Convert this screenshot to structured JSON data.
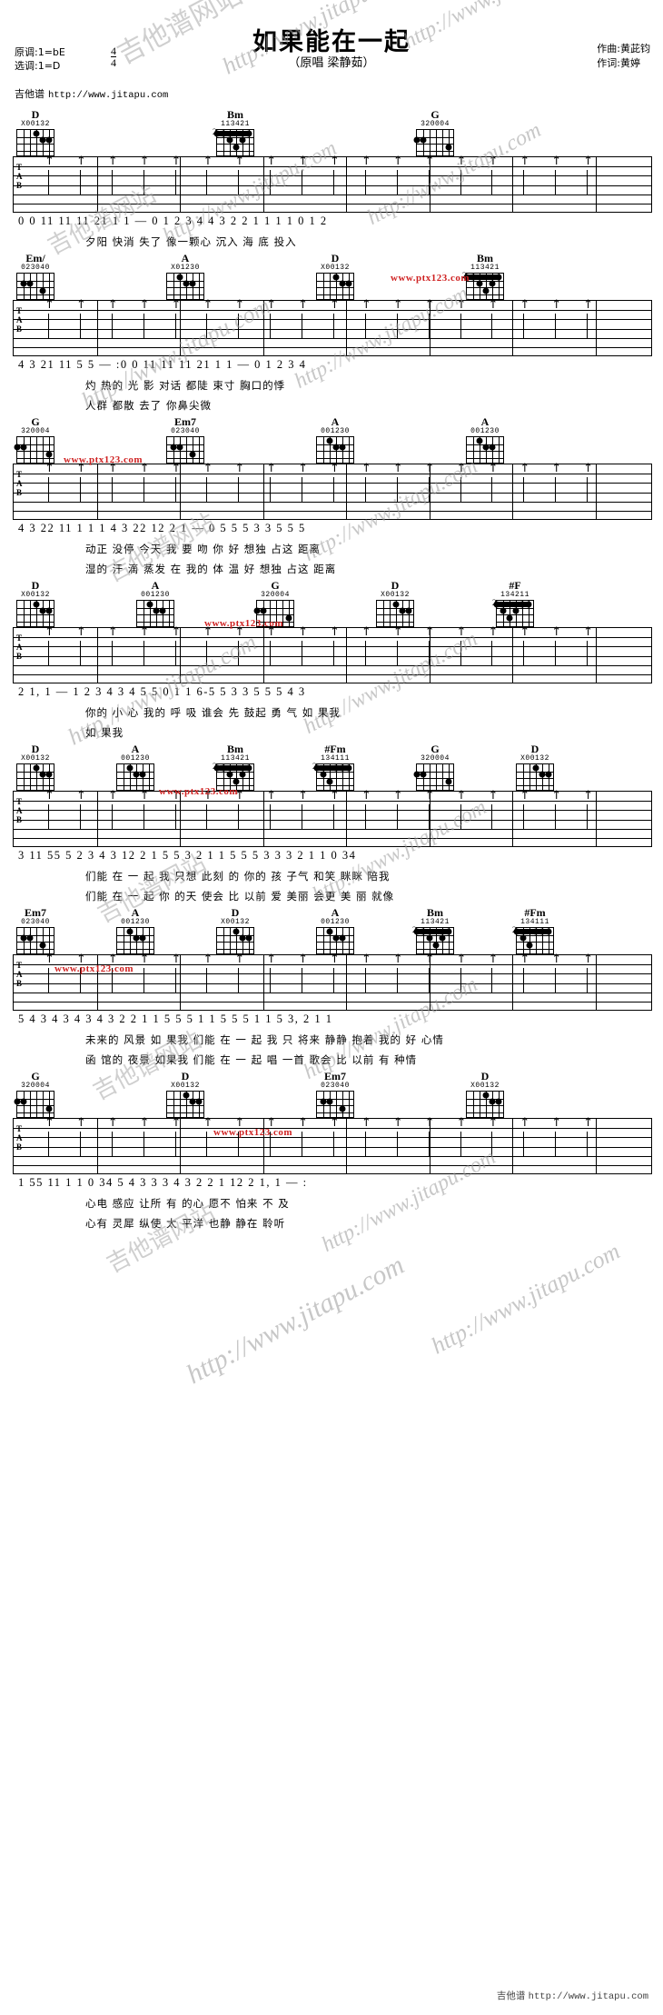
{
  "header": {
    "title": "如果能在一起",
    "subtitle": "（原唱 梁静茹）",
    "original_key_label": "原调:1=bE",
    "selected_key_label": "选调:1=D",
    "meter_numerator": "4",
    "meter_denominator": "4",
    "site_name": "吉他谱",
    "site_url": "http://www.jitapu.com",
    "composer": "作曲:黄茈钧",
    "lyricist": "作词:黄婷"
  },
  "watermarks": {
    "cn_text": "吉他谱网站",
    "url_text": "http://www.jitapu.com",
    "red_text": "www.ptx123.com"
  },
  "tab_label": "TAB",
  "footer": {
    "site_name": "吉他谱",
    "url": "http://www.jitapu.com"
  },
  "systems": [
    {
      "id": "system-1",
      "chords": [
        {
          "name": "D",
          "fingers": "X00132",
          "base": ""
        },
        {
          "name": "Bm",
          "fingers": "113421",
          "base": "2"
        },
        {
          "name": "G",
          "fingers": "320004",
          "base": ""
        }
      ],
      "numbers": "0   0 11 11 11 21  1   1 — 0      1 2 3 4   4  3 2 2 1 1     1 1   0 1 2",
      "lyrics": [
        "夕阳    快消    失了                          像一颗心     沉入 海 底       投入"
      ]
    },
    {
      "id": "system-2",
      "chords": [
        {
          "name": "Em/",
          "fingers": "023040",
          "base": ""
        },
        {
          "name": "A",
          "fingers": "X01230",
          "base": ""
        },
        {
          "name": "D",
          "fingers": "X00132",
          "base": ""
        },
        {
          "name": "Bm",
          "fingers": "113421",
          "base": "2"
        }
      ],
      "numbers": "4  3 21 11 5 5   —   :0   0 11 11 11 21  1   1 — 0     1 2 3 4",
      "lyrics": [
        "灼 热的 光 影                  对话    都陡  束寸                   胸口的悸",
        "                               人群    都散   去了                  你鼻尖微"
      ]
    },
    {
      "id": "system-3",
      "chords": [
        {
          "name": "G",
          "fingers": "320004",
          "base": ""
        },
        {
          "name": "Em7",
          "fingers": "023040",
          "base": ""
        },
        {
          "name": "A",
          "fingers": "001230",
          "base": ""
        },
        {
          "name": "A",
          "fingers": "001230",
          "base": ""
        }
      ],
      "numbers": "4  3 22 11 1   1 1  4  3 22 12  2 1    — 0         5 5 5 3 3 5 5 5",
      "lyrics": [
        "动正 没停     今天 我 要 吻 你            好 想独   占这 距离",
        "湿的 汗 滴     蒸发 在 我的 体 温          好 想独   占这 距离"
      ]
    },
    {
      "id": "system-4",
      "chords": [
        {
          "name": "D",
          "fingers": "X00132",
          "base": ""
        },
        {
          "name": "A",
          "fingers": "001230",
          "base": ""
        },
        {
          "name": "G",
          "fingers": "320004",
          "base": ""
        },
        {
          "name": "D",
          "fingers": "X00132",
          "base": ""
        },
        {
          "name": "#F",
          "fingers": "134211",
          "base": "2"
        }
      ],
      "numbers": "2 1,  1   —   1 2 3   4   3 4 5 5      0 1 1   6-5 5 3 3  5 5   5 4 3",
      "lyrics": [
        "     你的 小 心    我的 呼 吸     谁会 先 鼓起 勇 气      如 果我",
        "                                                         如 果我"
      ]
    },
    {
      "id": "system-5",
      "chords": [
        {
          "name": "D",
          "fingers": "X00132",
          "base": ""
        },
        {
          "name": "A",
          "fingers": "001230",
          "base": ""
        },
        {
          "name": "Bm",
          "fingers": "113421",
          "base": "2"
        },
        {
          "name": "#Fm",
          "fingers": "134111",
          "base": "2"
        },
        {
          "name": "G",
          "fingers": "320004",
          "base": ""
        },
        {
          "name": "D",
          "fingers": "X00132",
          "base": ""
        }
      ],
      "numbers": "3 11  55 5 2    3 4 3   12 2 1   5 5 3   2 1 1     5 5 5 3  3 3 2 1   1  0 34",
      "lyrics": [
        "们能  在 一 起 我 只想  此刻 的 你的  孩 子气   和笑 眯眯      陪我",
        "们能  在 一 起  你 的天  使会 比  以前  爱 美丽  会更 美 丽      就像"
      ]
    },
    {
      "id": "system-6",
      "chords": [
        {
          "name": "Em7",
          "fingers": "023040",
          "base": ""
        },
        {
          "name": "A",
          "fingers": "001230",
          "base": ""
        },
        {
          "name": "D",
          "fingers": "X00132",
          "base": ""
        },
        {
          "name": "A",
          "fingers": "001230",
          "base": ""
        },
        {
          "name": "Bm",
          "fingers": "113421",
          "base": "2"
        },
        {
          "name": "#Fm",
          "fingers": "134111",
          "base": "2"
        }
      ],
      "numbers": "5 4 3 4 3 4   3 4 3 2 2   1 1 5 5 5     1 1 5 5 5       1 1 5 3,  2 1 1",
      "lyrics": [
        "未来的  风景   如 果我   们能  在 一 起  我 只 将来  静静 抱着 我的 好 心情",
        "函 馆的 夜景   如果我  们能  在 一 起  唱 一首  歌会 比  以前  有 种情"
      ]
    },
    {
      "id": "system-7",
      "chords": [
        {
          "name": "G",
          "fingers": "320004",
          "base": ""
        },
        {
          "name": "D",
          "fingers": "X00132",
          "base": ""
        },
        {
          "name": "Em7",
          "fingers": "023040",
          "base": ""
        },
        {
          "name": "D",
          "fingers": "X00132",
          "base": ""
        }
      ],
      "numbers": "1  55 11 1    1    0 34   5 4 3   3 3 4 3 2 2  1 12   2 1,  1   — :",
      "lyrics": [
        "心电  感应   让所 有 的心  愿不   怕来  不 及",
        "心有  灵犀    纵使 太 平洋  也静   静在  聆听"
      ]
    }
  ]
}
